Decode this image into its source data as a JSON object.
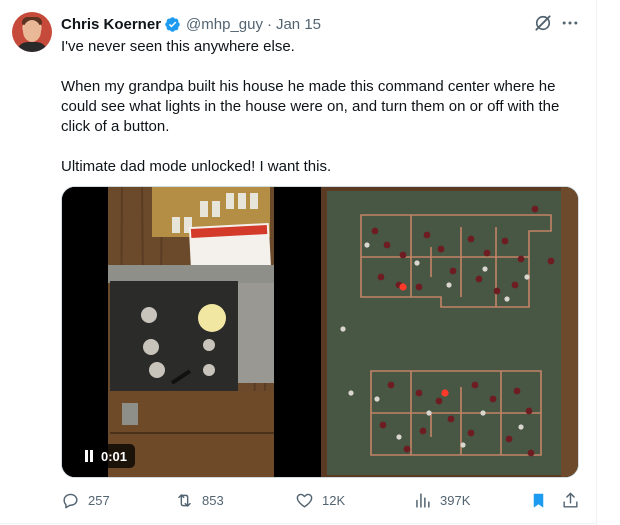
{
  "author": {
    "name": "Chris Koerner",
    "handle": "@mhp_guy",
    "separator": "·",
    "date": "Jan 15",
    "verified": true
  },
  "tweet": {
    "paragraphs": [
      "I've never seen this anywhere else.",
      "When my grandpa built his house he made this command center where he could see what lights in the house were on, and turn them on or off with the click of a button.",
      "Ultimate dad mode unlocked! I want this."
    ]
  },
  "media": {
    "video_time": "0:01",
    "left_description_icon": "video-player",
    "right_description_icon": "photo"
  },
  "actions": {
    "replies": "257",
    "reposts": "853",
    "likes": "12K",
    "views": "397K"
  },
  "colors": {
    "text": "#0f1419",
    "muted": "#536471",
    "verified": "#1d9bf0",
    "bookmark": "#1d9bf0",
    "border": "#cfd9de"
  },
  "icons": [
    "verified-badge-icon",
    "grok-icon",
    "more-icon",
    "pause-icon",
    "reply-icon",
    "repost-icon",
    "like-icon",
    "views-icon",
    "bookmark-icon",
    "share-icon"
  ]
}
